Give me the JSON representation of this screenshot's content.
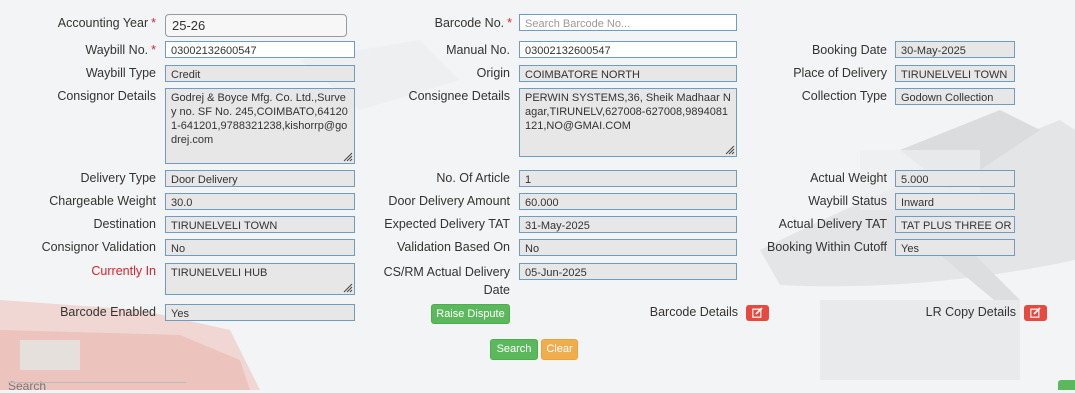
{
  "form": {
    "accounting_year": {
      "label": "Accounting Year",
      "value": "25-26"
    },
    "barcode_no": {
      "label": "Barcode No.",
      "placeholder": "Search Barcode No..."
    },
    "waybill_no": {
      "label": "Waybill No.",
      "value": "03002132600547"
    },
    "manual_no": {
      "label": "Manual No.",
      "value": "03002132600547"
    },
    "booking_date": {
      "label": "Booking Date",
      "value": "30-May-2025"
    },
    "waybill_type": {
      "label": "Waybill Type",
      "value": "Credit"
    },
    "origin": {
      "label": "Origin",
      "value": "COIMBATORE NORTH"
    },
    "place_of_delivery": {
      "label": "Place of Delivery",
      "value": "TIRUNELVELI TOWN"
    },
    "consignor_details": {
      "label": "Consignor Details",
      "value": "Godrej & Boyce Mfg. Co. Ltd.,Survey no. SF No. 245,COIMBATO,641201-641201,9788321238,kishorrp@godrej.com"
    },
    "consignee_details": {
      "label": "Consignee Details",
      "value": "PERWIN SYSTEMS,36, Sheik Madhaar Nagar,TIRUNELV,627008-627008,9894081121,NO@GMAI.COM"
    },
    "collection_type": {
      "label": "Collection Type",
      "value": "Godown Collection"
    },
    "delivery_type": {
      "label": "Delivery Type",
      "value": "Door Delivery"
    },
    "no_of_article": {
      "label": "No. Of Article",
      "value": "1"
    },
    "actual_weight": {
      "label": "Actual Weight",
      "value": "5.000"
    },
    "chargeable_weight": {
      "label": "Chargeable Weight",
      "value": "30.0"
    },
    "door_delivery_amount": {
      "label": "Door Delivery Amount",
      "value": "60.000"
    },
    "waybill_status": {
      "label": "Waybill Status",
      "value": "Inward"
    },
    "destination": {
      "label": "Destination",
      "value": "TIRUNELVELI TOWN"
    },
    "expected_delivery_tat": {
      "label": "Expected Delivery TAT",
      "value": "31-May-2025"
    },
    "actual_delivery_tat": {
      "label": "Actual Delivery TAT",
      "value": "TAT PLUS THREE OR MORE"
    },
    "consignor_validation": {
      "label": "Consignor Validation",
      "value": "No"
    },
    "validation_based_on": {
      "label": "Validation Based On",
      "value": "No"
    },
    "booking_within_cutoff": {
      "label": "Booking Within Cutoff",
      "value": "Yes"
    },
    "currently_in": {
      "label": "Currently In",
      "value": "TIRUNELVELI HUB"
    },
    "cs_rm_actual_delivery_date": {
      "label": "CS/RM Actual Delivery Date",
      "value": "05-Jun-2025"
    },
    "barcode_enabled": {
      "label": "Barcode Enabled",
      "value": "Yes"
    },
    "barcode_details": {
      "label": "Barcode Details"
    },
    "lr_copy_details": {
      "label": "LR Copy Details"
    },
    "required_marker": "*"
  },
  "buttons": {
    "raise_dispute": "Raise Dispute",
    "search": "Search",
    "clear": "Clear"
  },
  "footer": {
    "search_label": "Search"
  },
  "colors": {
    "required": "#d9232d",
    "field_border": "#6f9cc1",
    "button_green": "#5cb85c",
    "button_orange": "#f0ad4e",
    "icon_button_red": "#e8493f"
  },
  "icons": {
    "edit": "edit-icon",
    "resize": "resize-grip-icon"
  }
}
